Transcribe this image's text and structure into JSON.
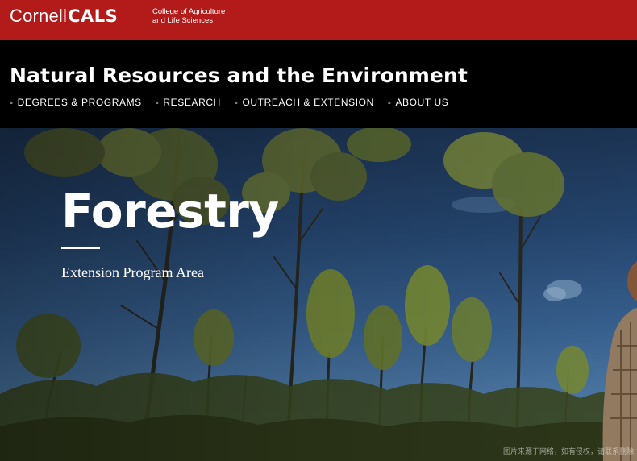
{
  "brand": {
    "cornell": "Cornell",
    "cals": "CALS",
    "college_line1": "College of Agriculture",
    "college_line2": "and Life Sciences",
    "color": "#b31b1b"
  },
  "header": {
    "title": "Natural Resources and the Environment",
    "nav": [
      {
        "label": "DEGREES & PROGRAMS"
      },
      {
        "label": "RESEARCH"
      },
      {
        "label": "OUTREACH & EXTENSION"
      },
      {
        "label": "ABOUT US"
      }
    ]
  },
  "hero": {
    "title": "Forestry",
    "subtitle": "Extension Program Area",
    "watermark": "图片来源于网络，如有侵权，请联系删除"
  }
}
